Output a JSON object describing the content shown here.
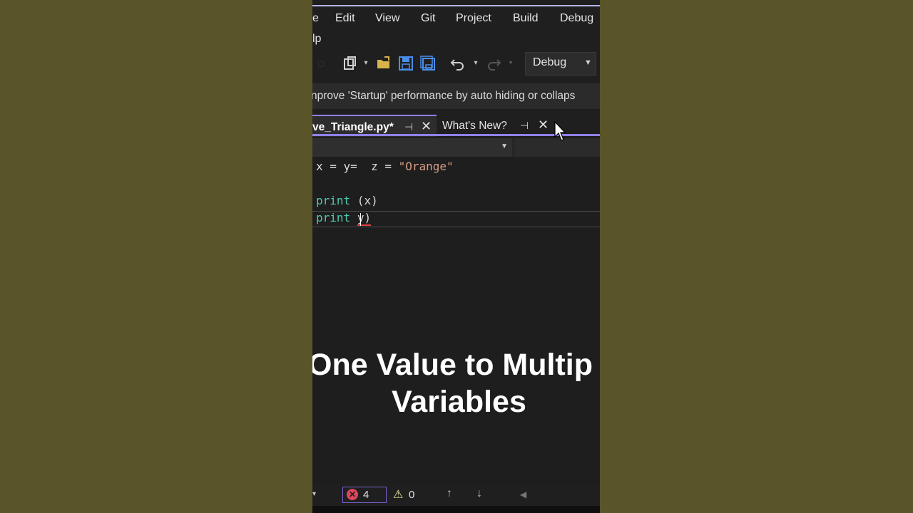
{
  "menu": {
    "items": [
      {
        "label": "e"
      },
      {
        "label": "Edit"
      },
      {
        "label": "View"
      },
      {
        "label": "Git"
      },
      {
        "label": "Project"
      },
      {
        "label": "Build"
      },
      {
        "label": "Debug"
      }
    ],
    "second_row": "lp"
  },
  "toolbar": {
    "configuration": "Debug",
    "icons": [
      "nav-back-icon",
      "new-project-icon",
      "open-folder-icon",
      "save-icon",
      "save-all-icon",
      "undo-icon",
      "redo-icon"
    ]
  },
  "notification": {
    "text": "nprove 'Startup' performance by auto hiding or collaps"
  },
  "tabs": [
    {
      "label": "ve_Triangle.py*",
      "active": true
    },
    {
      "label": "What's New?",
      "active": false
    }
  ],
  "code": {
    "line1": {
      "x": "x = y=  z = ",
      "str": "\"Orange\""
    },
    "line2": {
      "kw": "print",
      "rest": " (x)"
    },
    "line3": {
      "kw": "print",
      "rest_pre": " ",
      "err": "y)"
    }
  },
  "caption": {
    "line1": "One Value to Multip",
    "line2": "Variables"
  },
  "status": {
    "errors": "4",
    "warnings": "0"
  },
  "colors": {
    "accent": "#8f82ea",
    "keyword": "#4ec9b0",
    "string": "#d69d85",
    "outer_background": "#5a5429"
  }
}
